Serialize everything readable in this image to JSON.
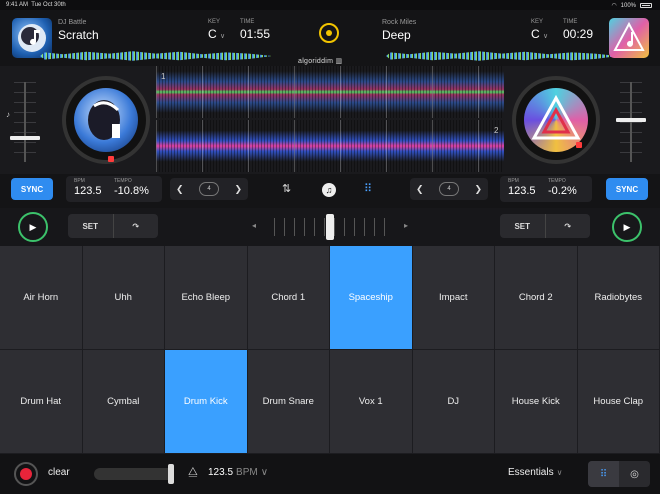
{
  "status": {
    "time": "9:41 AM",
    "date": "Tue Oct 30th",
    "battery": "100%"
  },
  "deck_left": {
    "artist": "DJ Battle",
    "title": "Scratch",
    "key_label": "KEY",
    "key": "C",
    "time_label": "TIME",
    "time": "01:55",
    "bpm_label": "BPM",
    "bpm": "123.5",
    "tempo_label": "TEMPO",
    "tempo": "-10.8%",
    "sync": "SYNC",
    "loop": "4",
    "set": "SET",
    "wave_num": "1"
  },
  "deck_right": {
    "artist": "Rock Miles",
    "title": "Deep",
    "key_label": "KEY",
    "key": "C",
    "time_label": "TIME",
    "time": "00:29",
    "bpm_label": "BPM",
    "bpm": "123.5",
    "tempo_label": "TEMPO",
    "tempo": "-0.2%",
    "sync": "SYNC",
    "loop": "4",
    "set": "SET",
    "wave_num": "2"
  },
  "logo": "algoriddim",
  "pads": {
    "row1": [
      "Air Horn",
      "Uhh",
      "Echo Bleep",
      "Chord 1",
      "Spaceship",
      "Impact",
      "Chord 2",
      "Radiobytes"
    ],
    "row2": [
      "Drum Hat",
      "Cymbal",
      "Drum Kick",
      "Drum Snare",
      "Vox 1",
      "DJ",
      "House Kick",
      "House Clap"
    ],
    "active": [
      "Spaceship",
      "Drum Kick"
    ]
  },
  "bottom": {
    "clear": "clear",
    "bpm": "123.5",
    "bpm_unit": "BPM",
    "preset": "Essentials"
  },
  "colors": {
    "accent": "#3aa0ff",
    "sync": "#2f8cf0",
    "play_ring": "#3cc26b",
    "record": "#e8243a",
    "center_ring": "#f2c400"
  }
}
